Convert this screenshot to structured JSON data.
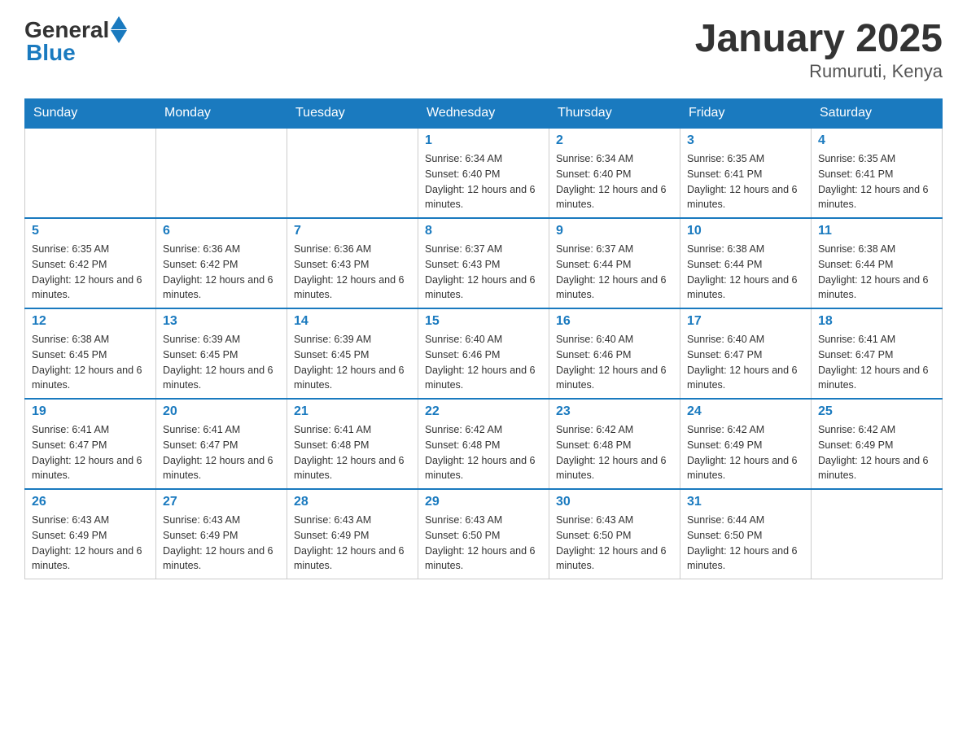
{
  "logo": {
    "general": "General",
    "blue": "Blue"
  },
  "title": "January 2025",
  "subtitle": "Rumuruti, Kenya",
  "weekdays": [
    "Sunday",
    "Monday",
    "Tuesday",
    "Wednesday",
    "Thursday",
    "Friday",
    "Saturday"
  ],
  "weeks": [
    [
      {
        "day": "",
        "info": ""
      },
      {
        "day": "",
        "info": ""
      },
      {
        "day": "",
        "info": ""
      },
      {
        "day": "1",
        "info": "Sunrise: 6:34 AM\nSunset: 6:40 PM\nDaylight: 12 hours and 6 minutes."
      },
      {
        "day": "2",
        "info": "Sunrise: 6:34 AM\nSunset: 6:40 PM\nDaylight: 12 hours and 6 minutes."
      },
      {
        "day": "3",
        "info": "Sunrise: 6:35 AM\nSunset: 6:41 PM\nDaylight: 12 hours and 6 minutes."
      },
      {
        "day": "4",
        "info": "Sunrise: 6:35 AM\nSunset: 6:41 PM\nDaylight: 12 hours and 6 minutes."
      }
    ],
    [
      {
        "day": "5",
        "info": "Sunrise: 6:35 AM\nSunset: 6:42 PM\nDaylight: 12 hours and 6 minutes."
      },
      {
        "day": "6",
        "info": "Sunrise: 6:36 AM\nSunset: 6:42 PM\nDaylight: 12 hours and 6 minutes."
      },
      {
        "day": "7",
        "info": "Sunrise: 6:36 AM\nSunset: 6:43 PM\nDaylight: 12 hours and 6 minutes."
      },
      {
        "day": "8",
        "info": "Sunrise: 6:37 AM\nSunset: 6:43 PM\nDaylight: 12 hours and 6 minutes."
      },
      {
        "day": "9",
        "info": "Sunrise: 6:37 AM\nSunset: 6:44 PM\nDaylight: 12 hours and 6 minutes."
      },
      {
        "day": "10",
        "info": "Sunrise: 6:38 AM\nSunset: 6:44 PM\nDaylight: 12 hours and 6 minutes."
      },
      {
        "day": "11",
        "info": "Sunrise: 6:38 AM\nSunset: 6:44 PM\nDaylight: 12 hours and 6 minutes."
      }
    ],
    [
      {
        "day": "12",
        "info": "Sunrise: 6:38 AM\nSunset: 6:45 PM\nDaylight: 12 hours and 6 minutes."
      },
      {
        "day": "13",
        "info": "Sunrise: 6:39 AM\nSunset: 6:45 PM\nDaylight: 12 hours and 6 minutes."
      },
      {
        "day": "14",
        "info": "Sunrise: 6:39 AM\nSunset: 6:45 PM\nDaylight: 12 hours and 6 minutes."
      },
      {
        "day": "15",
        "info": "Sunrise: 6:40 AM\nSunset: 6:46 PM\nDaylight: 12 hours and 6 minutes."
      },
      {
        "day": "16",
        "info": "Sunrise: 6:40 AM\nSunset: 6:46 PM\nDaylight: 12 hours and 6 minutes."
      },
      {
        "day": "17",
        "info": "Sunrise: 6:40 AM\nSunset: 6:47 PM\nDaylight: 12 hours and 6 minutes."
      },
      {
        "day": "18",
        "info": "Sunrise: 6:41 AM\nSunset: 6:47 PM\nDaylight: 12 hours and 6 minutes."
      }
    ],
    [
      {
        "day": "19",
        "info": "Sunrise: 6:41 AM\nSunset: 6:47 PM\nDaylight: 12 hours and 6 minutes."
      },
      {
        "day": "20",
        "info": "Sunrise: 6:41 AM\nSunset: 6:47 PM\nDaylight: 12 hours and 6 minutes."
      },
      {
        "day": "21",
        "info": "Sunrise: 6:41 AM\nSunset: 6:48 PM\nDaylight: 12 hours and 6 minutes."
      },
      {
        "day": "22",
        "info": "Sunrise: 6:42 AM\nSunset: 6:48 PM\nDaylight: 12 hours and 6 minutes."
      },
      {
        "day": "23",
        "info": "Sunrise: 6:42 AM\nSunset: 6:48 PM\nDaylight: 12 hours and 6 minutes."
      },
      {
        "day": "24",
        "info": "Sunrise: 6:42 AM\nSunset: 6:49 PM\nDaylight: 12 hours and 6 minutes."
      },
      {
        "day": "25",
        "info": "Sunrise: 6:42 AM\nSunset: 6:49 PM\nDaylight: 12 hours and 6 minutes."
      }
    ],
    [
      {
        "day": "26",
        "info": "Sunrise: 6:43 AM\nSunset: 6:49 PM\nDaylight: 12 hours and 6 minutes."
      },
      {
        "day": "27",
        "info": "Sunrise: 6:43 AM\nSunset: 6:49 PM\nDaylight: 12 hours and 6 minutes."
      },
      {
        "day": "28",
        "info": "Sunrise: 6:43 AM\nSunset: 6:49 PM\nDaylight: 12 hours and 6 minutes."
      },
      {
        "day": "29",
        "info": "Sunrise: 6:43 AM\nSunset: 6:50 PM\nDaylight: 12 hours and 6 minutes."
      },
      {
        "day": "30",
        "info": "Sunrise: 6:43 AM\nSunset: 6:50 PM\nDaylight: 12 hours and 6 minutes."
      },
      {
        "day": "31",
        "info": "Sunrise: 6:44 AM\nSunset: 6:50 PM\nDaylight: 12 hours and 6 minutes."
      },
      {
        "day": "",
        "info": ""
      }
    ]
  ]
}
